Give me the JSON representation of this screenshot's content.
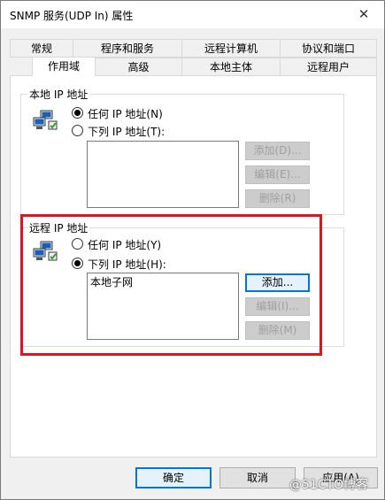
{
  "window": {
    "title": "SNMP 服务(UDP In) 属性",
    "close_glyph": "✕"
  },
  "tabs_top": [
    {
      "label": "常规"
    },
    {
      "label": "程序和服务"
    },
    {
      "label": "远程计算机"
    },
    {
      "label": "协议和端口"
    }
  ],
  "tabs_bottom": [
    {
      "label": "作用域",
      "active": true
    },
    {
      "label": "高级"
    },
    {
      "label": "本地主体"
    },
    {
      "label": "远程用户"
    }
  ],
  "local_ip": {
    "legend": "本地 IP 地址",
    "radio_any": "任何 IP 地址(N)",
    "radio_list": "下列 IP 地址(T):",
    "selected": "any",
    "list_items": [],
    "add_label": "添加(D)...",
    "edit_label": "编辑(E)...",
    "remove_label": "删除(R)",
    "icon": "network-computers-icon"
  },
  "remote_ip": {
    "legend": "远程 IP 地址",
    "radio_any": "任何 IP 地址(Y)",
    "radio_list": "下列 IP 地址(H):",
    "selected": "list",
    "list_items": [
      "本地子网"
    ],
    "add_label": "添加...",
    "edit_label": "编辑(I)...",
    "remove_label": "删除(M)",
    "icon": "network-computers-icon"
  },
  "footer": {
    "ok_label": "确定",
    "cancel_label": "取消",
    "apply_label": "应用(A)"
  },
  "watermark": "@51CTO博客",
  "colors": {
    "highlight_frame": "#e0141e",
    "focus_accent": "#0078d7"
  }
}
